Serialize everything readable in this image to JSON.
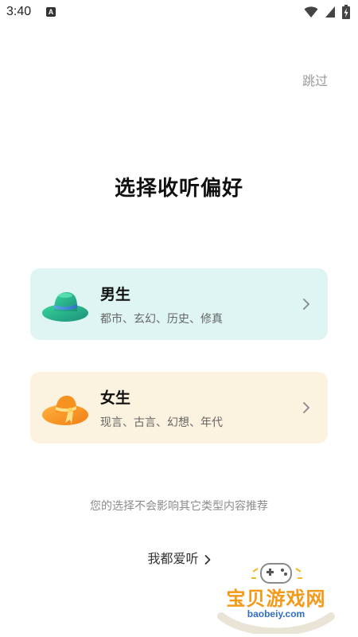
{
  "status_bar": {
    "time": "3:40",
    "notification_letter": "A",
    "icons": [
      "wifi-icon",
      "signal-icon",
      "battery-icon"
    ]
  },
  "header": {
    "skip_label": "跳过"
  },
  "main": {
    "title": "选择收听偏好",
    "options": [
      {
        "title": "男生",
        "tags": "都市、玄幻、历史、修真",
        "icon": "green-hat-icon",
        "bg_color": "#dff5f3"
      },
      {
        "title": "女生",
        "tags": "现言、古言、幻想、年代",
        "icon": "orange-hat-icon",
        "bg_color": "#fbf3df"
      }
    ],
    "note": "您的选择不会影响其它类型内容推荐",
    "all_label": "我都爱听"
  },
  "watermark": {
    "text": "宝贝游戏网",
    "url": "baobeiy.com",
    "icon": "gamepad-logo"
  }
}
